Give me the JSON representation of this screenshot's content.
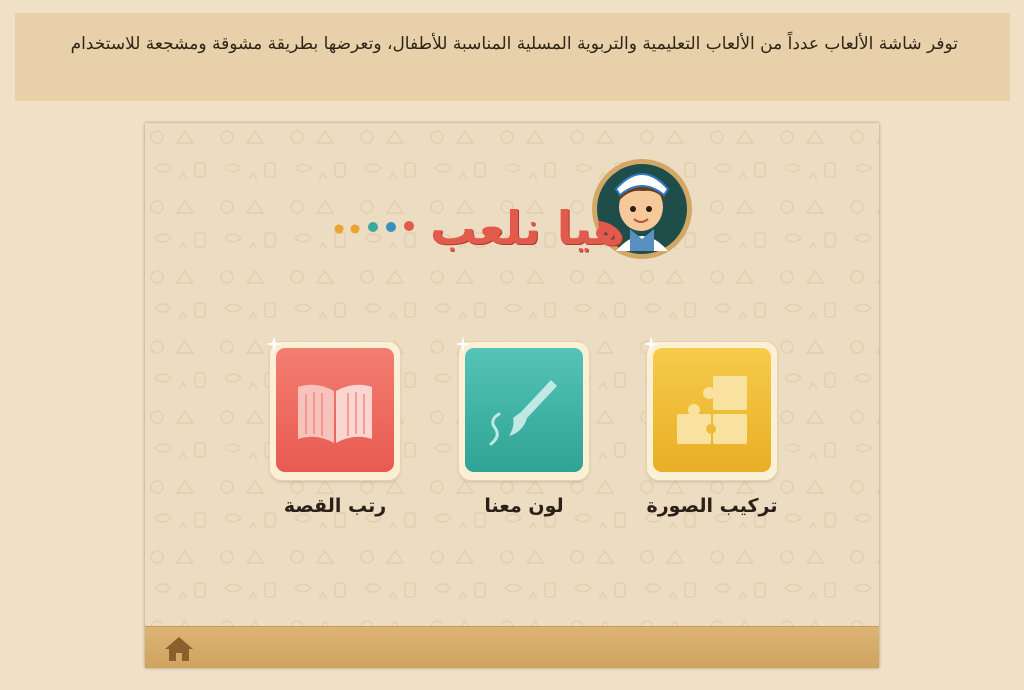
{
  "banner": {
    "text": "توفر شاشة الألعاب عدداً من الألعاب التعليمية والتربوية المسلية المناسبة للأطفال، وتعرضها بطريقة مشوقة ومشجعة للاستخدام"
  },
  "app": {
    "logo_title": "هيا نلعب",
    "tiles": [
      {
        "label": "رتب القصة",
        "icon": "book-icon",
        "color": "#ef6a5e"
      },
      {
        "label": "لون معنا",
        "icon": "paintbrush-icon",
        "color": "#3fb5a6"
      },
      {
        "label": "تركيب الصورة",
        "icon": "puzzle-icon",
        "color": "#eebb35"
      }
    ],
    "footer": {
      "icon": "home-icon"
    }
  }
}
